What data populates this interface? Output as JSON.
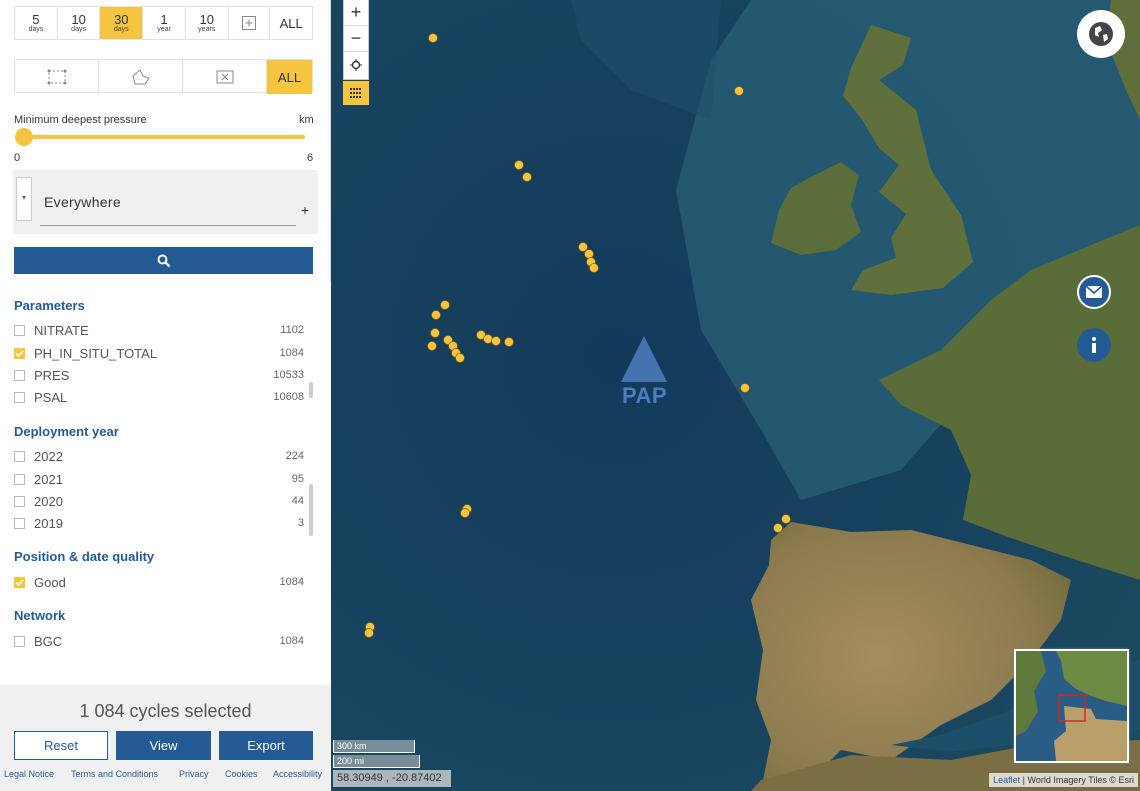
{
  "time_filter": {
    "options": [
      {
        "num": "5",
        "unit": "days",
        "active": false
      },
      {
        "num": "10",
        "unit": "days",
        "active": false
      },
      {
        "num": "30",
        "unit": "days",
        "active": true
      },
      {
        "num": "1",
        "unit": "year",
        "active": false
      },
      {
        "num": "10",
        "unit": "years",
        "active": false
      }
    ],
    "all_label": "ALL"
  },
  "area_filter": {
    "all_label": "ALL",
    "active": "ALL"
  },
  "pressure": {
    "label": "Minimum deepest pressure",
    "unit": "km",
    "min": "0",
    "max": "6",
    "value": 0
  },
  "location": {
    "value": "Everywhere",
    "dropdown_glyph": "▾",
    "add_glyph": "+"
  },
  "sections": [
    {
      "title": "Parameters",
      "items": [
        {
          "label": "NITRATE",
          "count": "1102",
          "checked": false
        },
        {
          "label": "PH_IN_SITU_TOTAL",
          "count": "1084",
          "checked": true
        },
        {
          "label": "PRES",
          "count": "10533",
          "checked": false
        },
        {
          "label": "PSAL",
          "count": "10608",
          "checked": false
        }
      ]
    },
    {
      "title": "Deployment year",
      "items": [
        {
          "label": "2022",
          "count": "224",
          "checked": false
        },
        {
          "label": "2021",
          "count": "95",
          "checked": false
        },
        {
          "label": "2020",
          "count": "44",
          "checked": false
        },
        {
          "label": "2019",
          "count": "3",
          "checked": false
        }
      ]
    },
    {
      "title": "Position & date quality",
      "items": [
        {
          "label": "Good",
          "count": "1084",
          "checked": true
        }
      ]
    },
    {
      "title": "Network",
      "items": [
        {
          "label": "BGC",
          "count": "1084",
          "checked": false
        }
      ]
    }
  ],
  "summary": {
    "selected_text": "1 084 cycles selected"
  },
  "actions": {
    "reset": "Reset",
    "view": "View",
    "export": "Export"
  },
  "footer": {
    "legal": "Legal Notice",
    "terms": "Terms and Conditions",
    "privacy": "Privacy",
    "cookies": "Cookies",
    "accessibility": "Accessibility"
  },
  "map": {
    "zoom_in": "+",
    "zoom_out": "−",
    "station_label": "PAP",
    "scale_km": "300 km",
    "scale_mi": "200 mi",
    "coordinates": "58.30949 , -20.87402",
    "attribution_link": "Leaflet",
    "attribution_text": " | World Imagery Tiles © Esri",
    "colors": {
      "accent": "#f5c440",
      "brand": "#245b95",
      "ocean": "#153a56",
      "land": "#5d6e3a",
      "station": "#4a78b8"
    }
  }
}
